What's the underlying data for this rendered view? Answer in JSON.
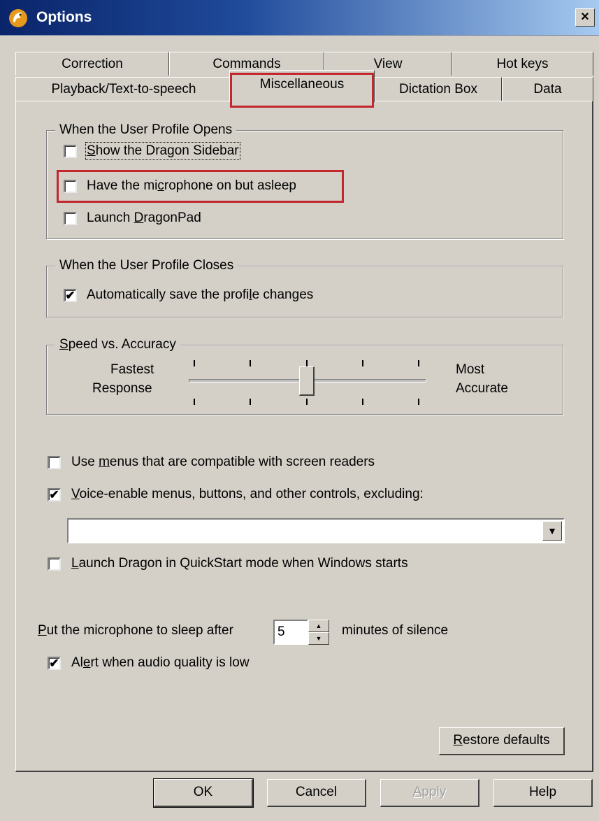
{
  "window": {
    "title": "Options",
    "close_label": "×"
  },
  "tabs": {
    "row_back": [
      "Correction",
      "Commands",
      "View",
      "Hot keys"
    ],
    "row_front": [
      "Playback/Text-to-speech",
      "Miscellaneous",
      "Dictation Box",
      "Data"
    ],
    "selected": "Miscellaneous"
  },
  "profile_opens": {
    "legend": "When the User Profile Opens",
    "show_sidebar": {
      "pre": "",
      "ul": "S",
      "post": "how the Dragon Sidebar",
      "checked": false
    },
    "mic_asleep": {
      "pre": "Have the mi",
      "ul": "c",
      "post": "rophone on but asleep",
      "checked": false
    },
    "launch_dragonpad": {
      "pre": "Launch ",
      "ul": "D",
      "post": "ragonPad",
      "checked": false
    }
  },
  "profile_closes": {
    "legend": "When the User Profile Closes",
    "auto_save": {
      "pre": "Automatically save the profi",
      "ul": "l",
      "post": "e changes",
      "checked": true
    }
  },
  "speed_accuracy": {
    "legend": {
      "ul": "S",
      "post": "peed vs. Accuracy"
    },
    "left_line1": "Fastest",
    "left_line2": "Response",
    "right_line1": "Most",
    "right_line2": "Accurate",
    "ticks": 5,
    "value_position": 3
  },
  "screen_readers": {
    "pre": "Use ",
    "ul": "m",
    "post": "enus that are compatible with screen readers",
    "checked": false
  },
  "voice_enable": {
    "pre": "",
    "ul": "V",
    "post": "oice-enable menus, buttons, and other controls, excluding:",
    "checked": true
  },
  "exclusion_combo": {
    "value": ""
  },
  "quickstart": {
    "pre": "",
    "ul": "L",
    "post": "aunch Dragon in QuickStart mode when Windows starts",
    "checked": false
  },
  "mic_sleep": {
    "pre": "",
    "ul": "P",
    "post": "ut the microphone to sleep after",
    "value": "5",
    "suffix": "minutes of silence"
  },
  "audio_alert": {
    "pre": "Al",
    "ul": "e",
    "post": "rt when audio quality is low",
    "checked": true
  },
  "restore_defaults": {
    "ul": "R",
    "post": "estore defaults"
  },
  "buttons": {
    "ok": "OK",
    "cancel": "Cancel",
    "apply_ul": "A",
    "apply_post": "pply",
    "help": "Help"
  },
  "check_glyph": "✔"
}
